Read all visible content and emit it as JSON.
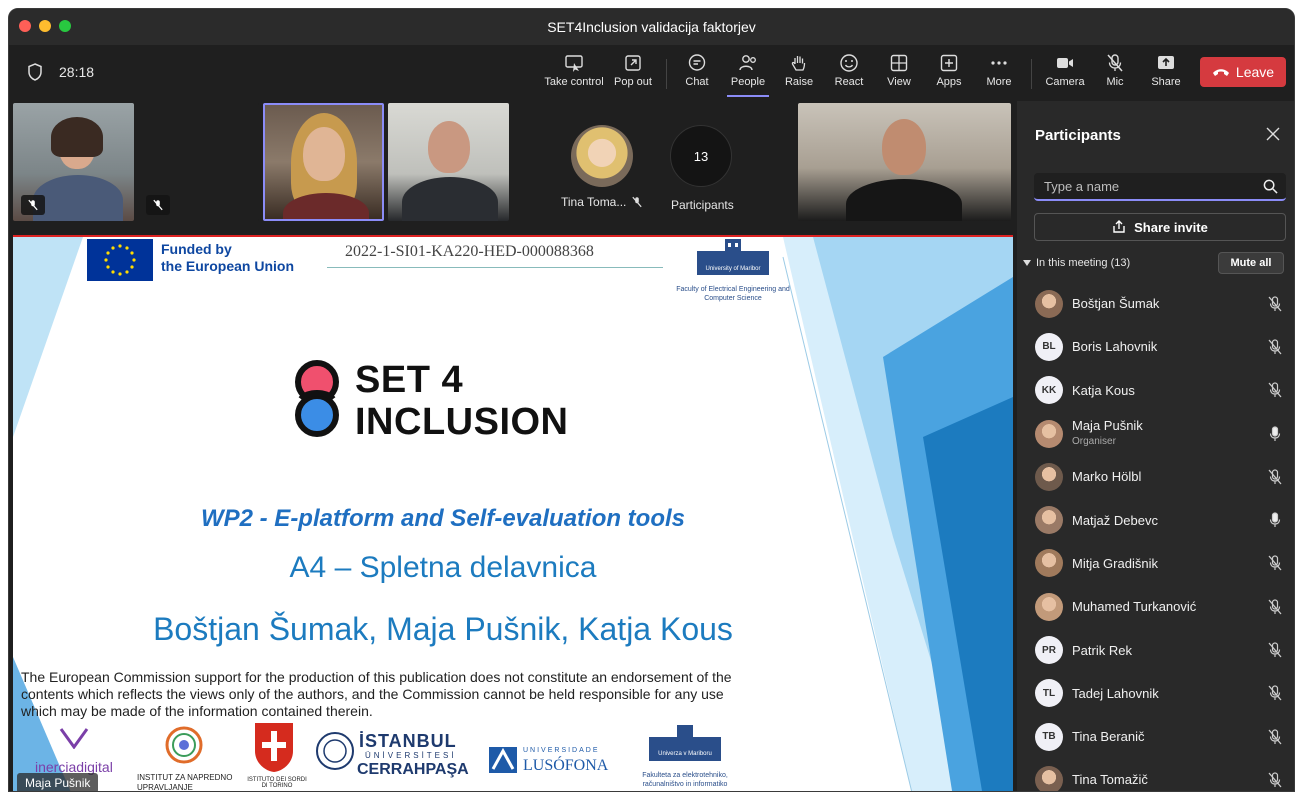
{
  "window": {
    "title": "SET4Inclusion validacija faktorjev"
  },
  "toolbar": {
    "timer": "28:18",
    "buttons": {
      "take_control": "Take control",
      "pop_out": "Pop out",
      "chat": "Chat",
      "people": "People",
      "raise": "Raise",
      "react": "React",
      "view": "View",
      "apps": "Apps",
      "more": "More",
      "camera": "Camera",
      "mic": "Mic",
      "share": "Share"
    },
    "leave": "Leave",
    "colors": {
      "leave": "#d53a3f",
      "active_underline": "#8b8cf7"
    }
  },
  "stage": {
    "avatar_tile_name": "Tina Toma...",
    "participants_count": "13",
    "participants_label": "Participants",
    "presenter_label": "Maja Pušnik"
  },
  "slide": {
    "funded_by": "Funded by",
    "eu": "the European Union",
    "project_code": "2022-1-SI01-KA220-HED-000088368",
    "um_name": "University of Maribor",
    "um_caption": "Faculty of Electrical Engineering and Computer Science",
    "set4_line1": "SET 4",
    "set4_line2": "INCLUSION",
    "wp2": "WP2 - E-platform and Self-evaluation tools",
    "a4": "A4 – Spletna delavnica",
    "authors": "Boštjan Šumak, Maja Pušnik, Katja Kous",
    "disclaimer": "The European Commission support for the production of this publication does not constitute an endorsement of the contents which reflects the views only of the authors, and the Commission cannot be held responsible for any use which may be made of the information contained therein.",
    "logos": {
      "inercia": "inerciadigital",
      "nuk": "INSTITUT ZA NAPREDNO UPRAVLJANJE KOMUNIKACIJ",
      "sordi": "ISTITUTO DEI SORDI DI TORINO",
      "istanbul1": "İSTANBUL",
      "istanbul2": "ÜNİVERSİTESİ",
      "istanbul3": "CERRAHPAŞA",
      "lusofona1": "UNIVERSIDADE",
      "lusofona2": "LUSÓFONA",
      "um_slo": "Univerza v Mariboru",
      "feri": "Fakulteta za elektrotehniko, računalništvo in informatiko"
    }
  },
  "panel": {
    "title": "Participants",
    "search_placeholder": "Type a name",
    "share_invite": "Share invite",
    "in_meeting": "In this meeting (13)",
    "mute_all": "Mute all",
    "participants": [
      {
        "name": "Boštjan Šumak",
        "initials": "",
        "role": "",
        "mic": "muted"
      },
      {
        "name": "Boris Lahovnik",
        "initials": "BL",
        "role": "",
        "mic": "muted"
      },
      {
        "name": "Katja Kous",
        "initials": "KK",
        "role": "",
        "mic": "muted"
      },
      {
        "name": "Maja Pušnik",
        "initials": "",
        "role": "Organiser",
        "mic": "on"
      },
      {
        "name": "Marko Hölbl",
        "initials": "",
        "role": "",
        "mic": "muted"
      },
      {
        "name": "Matjaž Debevc",
        "initials": "",
        "role": "",
        "mic": "on"
      },
      {
        "name": "Mitja Gradišnik",
        "initials": "",
        "role": "",
        "mic": "muted"
      },
      {
        "name": "Muhamed Turkanović",
        "initials": "",
        "role": "",
        "mic": "muted"
      },
      {
        "name": "Patrik Rek",
        "initials": "PR",
        "role": "",
        "mic": "muted"
      },
      {
        "name": "Tadej Lahovnik",
        "initials": "TL",
        "role": "",
        "mic": "muted"
      },
      {
        "name": "Tina Beranič",
        "initials": "TB",
        "role": "",
        "mic": "muted"
      },
      {
        "name": "Tina Tomažič",
        "initials": "",
        "role": "",
        "mic": "muted"
      }
    ]
  }
}
